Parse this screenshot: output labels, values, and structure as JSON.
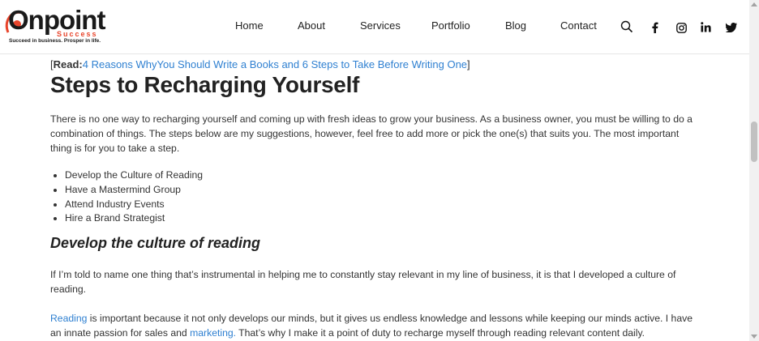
{
  "logo": {
    "brand": "Onpoint",
    "sub": "Success",
    "tagline": "Succeed in business. Prosper in life."
  },
  "nav": {
    "items": [
      "Home",
      "About",
      "Services",
      "Portfolio",
      "Blog",
      "Contact"
    ]
  },
  "icons": {
    "search": "search-icon",
    "facebook": "facebook-icon",
    "instagram": "instagram-icon",
    "linkedin": "linkedin-icon",
    "twitter": "twitter-icon"
  },
  "article": {
    "read_prefix": "Read:",
    "read_link": "4 Reasons WhyYou Should Write a Books and 6 Steps to Take Before Writing One",
    "title": "Steps to Recharging Yourself",
    "intro": "There is no one way to recharging yourself and coming up with fresh ideas to grow your business. As a business owner, you must be willing to do a combination of things. The steps below are my suggestions, however, feel free to add more or pick the one(s) that suits you. The most important thing is for you to take a step.",
    "steps": [
      "Develop the Culture of Reading",
      "Have a Mastermind Group",
      "Attend Industry Events",
      "Hire a Brand Strategist"
    ],
    "section_title": "Develop the culture of reading",
    "para2": "If I’m told to name one thing that’s instrumental in helping me to constantly stay relevant in my line of business, it is that I developed a culture of reading.",
    "para3_link1": "Reading",
    "para3_a": " is important because it not only develops our minds, but it gives us endless knowledge and lessons while keeping our minds active. I have an innate passion for sales and ",
    "para3_link2": "marketing.",
    "para3_b": " That’s why I make it a point of duty to recharge myself through reading relevant content daily."
  },
  "colors": {
    "link": "#2f80d1",
    "brand_accent": "#e8452c"
  }
}
